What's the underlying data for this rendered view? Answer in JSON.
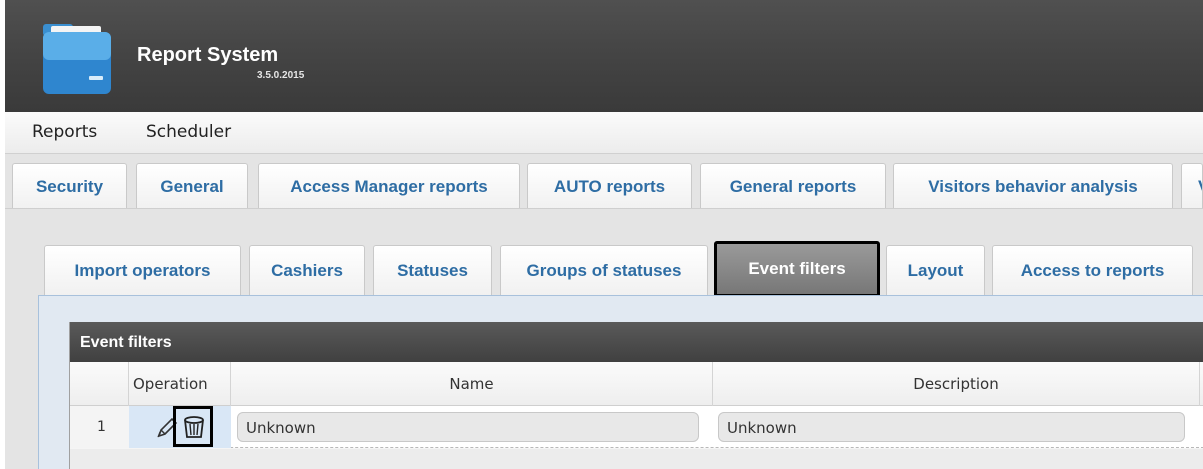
{
  "app": {
    "title": "Report System",
    "version": "3.5.0.2015"
  },
  "menu": {
    "items": [
      {
        "label": "Reports"
      },
      {
        "label": "Scheduler"
      }
    ]
  },
  "top_tabs": [
    {
      "label": "Security"
    },
    {
      "label": "General"
    },
    {
      "label": "Access Manager reports"
    },
    {
      "label": "AUTO reports"
    },
    {
      "label": "General reports"
    },
    {
      "label": "Visitors behavior analysis"
    },
    {
      "label": "V"
    }
  ],
  "sub_tabs": [
    {
      "label": "Import operators"
    },
    {
      "label": "Cashiers"
    },
    {
      "label": "Statuses"
    },
    {
      "label": "Groups of statuses"
    },
    {
      "label": "Event filters",
      "active": true
    },
    {
      "label": "Layout"
    },
    {
      "label": "Access to reports"
    }
  ],
  "grid": {
    "caption": "Event filters",
    "columns": [
      "Operation",
      "Name",
      "Description"
    ],
    "rows": [
      {
        "num": "1",
        "name": "Unknown",
        "description": "Unknown"
      }
    ]
  },
  "colors": {
    "tab_text": "#2e6da4",
    "header_bg": "#454545",
    "active_tab_bg": "#888888"
  },
  "icons": {
    "logo": "folder-icon",
    "edit": "pencil-icon",
    "delete": "trash-icon"
  }
}
